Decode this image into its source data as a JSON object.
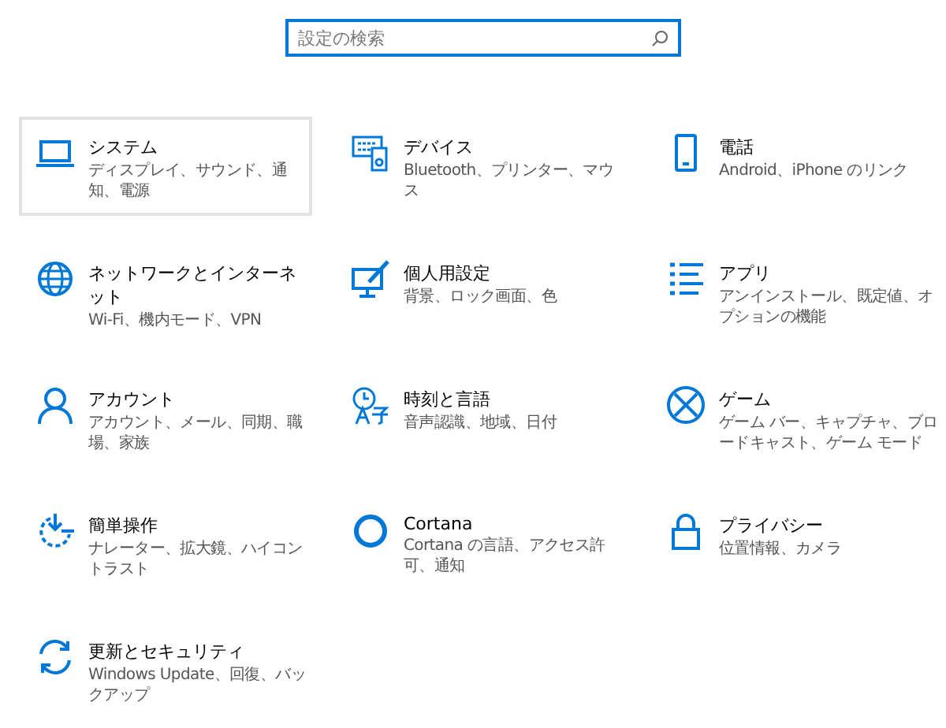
{
  "search": {
    "placeholder": "設定の検索"
  },
  "tiles": [
    {
      "title": "システム",
      "subtitle": "ディスプレイ、サウンド、通知、電源",
      "selected": true
    },
    {
      "title": "デバイス",
      "subtitle": "Bluetooth、プリンター、マウス",
      "selected": false
    },
    {
      "title": "電話",
      "subtitle": "Android、iPhone のリンク",
      "selected": false
    },
    {
      "title": "ネットワークとインターネット",
      "subtitle": "Wi-Fi、機内モード、VPN",
      "selected": false
    },
    {
      "title": "個人用設定",
      "subtitle": "背景、ロック画面、色",
      "selected": false
    },
    {
      "title": "アプリ",
      "subtitle": "アンインストール、既定値、オプションの機能",
      "selected": false
    },
    {
      "title": "アカウント",
      "subtitle": "アカウント、メール、同期、職場、家族",
      "selected": false
    },
    {
      "title": "時刻と言語",
      "subtitle": "音声認識、地域、日付",
      "selected": false
    },
    {
      "title": "ゲーム",
      "subtitle": "ゲーム バー、キャプチャ、ブロードキャスト、ゲーム モード",
      "selected": false
    },
    {
      "title": "簡単操作",
      "subtitle": "ナレーター、拡大鏡、ハイコントラスト",
      "selected": false
    },
    {
      "title": "Cortana",
      "subtitle": "Cortana の言語、アクセス許可、通知",
      "selected": false
    },
    {
      "title": "プライバシー",
      "subtitle": "位置情報、カメラ",
      "selected": false
    },
    {
      "title": "更新とセキュリティ",
      "subtitle": "Windows Update、回復、バックアップ",
      "selected": false
    }
  ]
}
